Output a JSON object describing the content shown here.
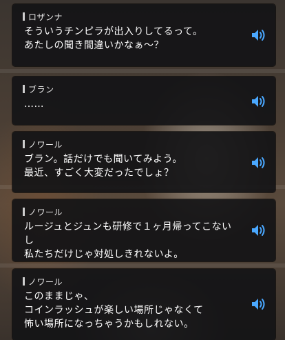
{
  "dialogue_log": [
    {
      "speaker": "ロザンナ",
      "text": "そういうチンピラが出入りしてるって。\nあたしの聞き間違いかなぁ～？",
      "voice_icon": "speaker-icon"
    },
    {
      "speaker": "ブラン",
      "text": "……",
      "voice_icon": "speaker-icon"
    },
    {
      "speaker": "ノワール",
      "text": "ブラン。話だけでも聞いてみよう。\n最近、すごく大変だったでしょ？",
      "voice_icon": "speaker-icon"
    },
    {
      "speaker": "ノワール",
      "text": "ルージュとジュンも研修で１ヶ月帰ってこないし\n私たちだけじゃ対処しきれないよ。",
      "voice_icon": "speaker-icon"
    },
    {
      "speaker": "ノワール",
      "text": "このままじゃ、\nコインラッシュが楽しい場所じゃなくて\n怖い場所になっちゃうかもしれない。",
      "voice_icon": "speaker-icon"
    }
  ],
  "colors": {
    "panel": "#141416",
    "text": "#ffffff",
    "speaker": "#e8e8e8",
    "voice_icon": "#4aa8ff"
  }
}
